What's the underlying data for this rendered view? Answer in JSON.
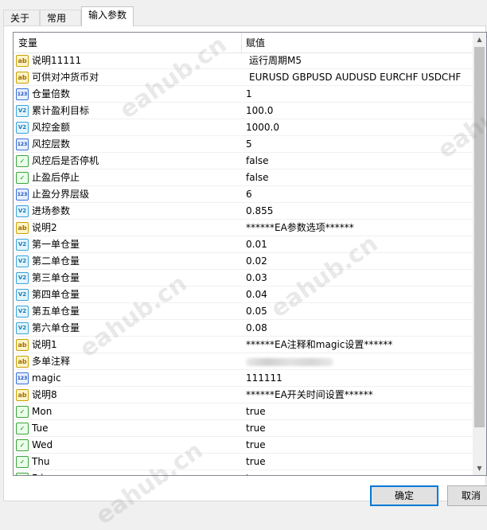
{
  "tabs": [
    {
      "label": "关于"
    },
    {
      "label": "常用"
    },
    {
      "label": "输入参数",
      "active": true
    }
  ],
  "grid": {
    "col_variable": "变量",
    "col_value": "赋值",
    "rows": [
      {
        "type": "ab",
        "icon_text": "ab",
        "name": "说明11111",
        "value": "运行周期M5"
      },
      {
        "type": "ab",
        "icon_text": "ab",
        "name": "可供对冲货币对",
        "value": "EURUSD GBPUSD  AUDUSD EURCHF USDCHF"
      },
      {
        "type": "123",
        "icon_text": "123",
        "name": "仓量倍数",
        "value": "1"
      },
      {
        "type": "v2",
        "icon_text": "V2",
        "name": "累计盈利目标",
        "value": "100.0"
      },
      {
        "type": "v2",
        "icon_text": "V2",
        "name": "风控金额",
        "value": "1000.0"
      },
      {
        "type": "123",
        "icon_text": "123",
        "name": "风控层数",
        "value": "5"
      },
      {
        "type": "bool",
        "icon_text": "✓",
        "name": "风控后是否停机",
        "value": "false"
      },
      {
        "type": "bool",
        "icon_text": "✓",
        "name": "止盈后停止",
        "value": "false"
      },
      {
        "type": "123",
        "icon_text": "123",
        "name": "止盈分界层级",
        "value": "6"
      },
      {
        "type": "v2",
        "icon_text": "V2",
        "name": "进场参数",
        "value": "0.855"
      },
      {
        "type": "ab",
        "icon_text": "ab",
        "name": "说明2",
        "value": "******EA参数选项******"
      },
      {
        "type": "v2",
        "icon_text": "V2",
        "name": "第一单仓量",
        "value": "0.01"
      },
      {
        "type": "v2",
        "icon_text": "V2",
        "name": "第二单仓量",
        "value": "0.02"
      },
      {
        "type": "v2",
        "icon_text": "V2",
        "name": "第三单仓量",
        "value": "0.03"
      },
      {
        "type": "v2",
        "icon_text": "V2",
        "name": "第四单仓量",
        "value": "0.04"
      },
      {
        "type": "v2",
        "icon_text": "V2",
        "name": "第五单仓量",
        "value": "0.05"
      },
      {
        "type": "v2",
        "icon_text": "V2",
        "name": "第六单仓量",
        "value": "0.08"
      },
      {
        "type": "ab",
        "icon_text": "ab",
        "name": "说明1",
        "value": "******EA注释和magic设置******"
      },
      {
        "type": "ab",
        "icon_text": "ab",
        "name": "多单注释",
        "value": "",
        "blurred": true
      },
      {
        "type": "123",
        "icon_text": "123",
        "name": "magic",
        "value": "111111"
      },
      {
        "type": "ab",
        "icon_text": "ab",
        "name": "说明8",
        "value": "******EA开关时间设置******"
      },
      {
        "type": "bool",
        "icon_text": "✓",
        "name": "Mon",
        "value": "true"
      },
      {
        "type": "bool",
        "icon_text": "✓",
        "name": "Tue",
        "value": "true"
      },
      {
        "type": "bool",
        "icon_text": "✓",
        "name": "Wed",
        "value": "true"
      },
      {
        "type": "bool",
        "icon_text": "✓",
        "name": "Thu",
        "value": "true"
      },
      {
        "type": "bool",
        "icon_text": "✓",
        "name": "Fri",
        "value": "true"
      }
    ]
  },
  "buttons": {
    "ok": "确定",
    "cancel": "取消"
  },
  "watermark": "eahub.cn",
  "colors": {
    "accent": "#0078d7",
    "scroll_thumb": "#c2c2c2"
  }
}
